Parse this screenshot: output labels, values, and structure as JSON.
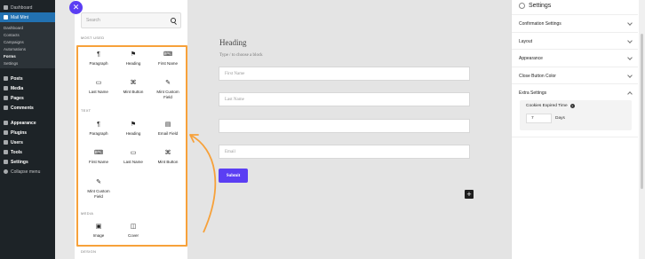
{
  "wp_menu": {
    "items_top": [
      {
        "label": "Dashboard",
        "icon": "dashboard-icon"
      },
      {
        "label": "Mail Mint",
        "icon": "mail-mint-icon"
      }
    ],
    "submenu": [
      "Dashboard",
      "Contacts",
      "Campaigns",
      "Automations",
      "Forms",
      "Settings"
    ],
    "items_bottom": [
      {
        "label": "Posts",
        "icon": "pin-icon"
      },
      {
        "label": "Media",
        "icon": "media-icon"
      },
      {
        "label": "Pages",
        "icon": "page-icon"
      },
      {
        "label": "Comments",
        "icon": "comments-icon"
      },
      {
        "label": "Appearance",
        "icon": "brush-icon"
      },
      {
        "label": "Plugins",
        "icon": "plugin-icon"
      },
      {
        "label": "Users",
        "icon": "users-icon"
      },
      {
        "label": "Tools",
        "icon": "wrench-icon"
      },
      {
        "label": "Settings",
        "icon": "settings-icon"
      },
      {
        "label": "Collapse menu",
        "icon": "collapse-icon"
      }
    ]
  },
  "inserter": {
    "search_placeholder": "Search",
    "categories": {
      "most_used": "MOST USED",
      "text": "TEXT",
      "media": "MEDIA",
      "design": "DESIGN"
    },
    "most_used": [
      "Paragraph",
      "Heading",
      "First Name",
      "Last Name",
      "Mint Button",
      "Mint Custom Field"
    ],
    "text": [
      "Paragraph",
      "Heading",
      "Email Field",
      "First Name",
      "Last Name",
      "Mint Button",
      "Mint Custom Field"
    ],
    "media": [
      "Image",
      "Cover"
    ]
  },
  "form": {
    "heading": "Heading",
    "paragraph": "Type / to choose a block",
    "first_name_placeholder": "First Name",
    "last_name_placeholder": "Last Name",
    "email_placeholder": "Email",
    "submit_label": "Submit"
  },
  "settings": {
    "title": "Settings",
    "sections": [
      "Confirmation Settings",
      "Layout",
      "Appearance",
      "Close Button Color",
      "Extra Settings"
    ],
    "cookie_label": "Cookies Expired Time",
    "cookie_value": "7",
    "cookie_unit": "Days"
  },
  "colors": {
    "accent": "#5b3ef3",
    "highlight": "#f7a13a",
    "wp_sidebar": "#1d2327",
    "wp_active": "#2271b1"
  }
}
